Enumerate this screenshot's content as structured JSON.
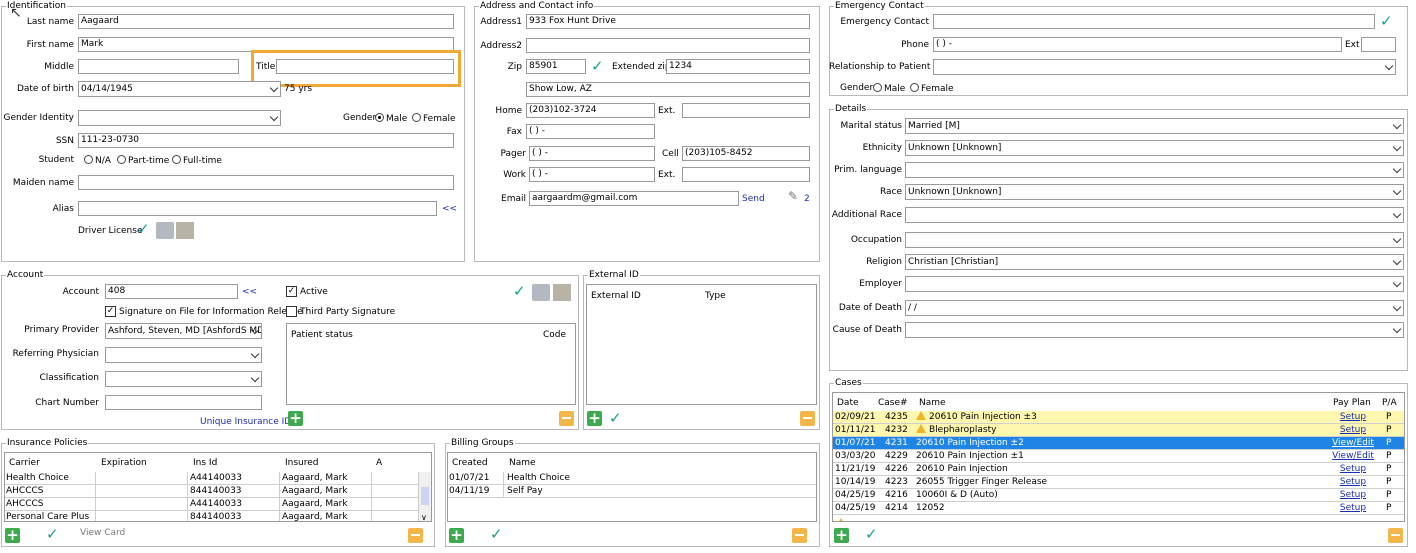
{
  "identification": {
    "legend": "Identification",
    "last_name_label": "Last name",
    "last_name": "Aagaard",
    "first_name_label": "First name",
    "first_name": "Mark",
    "middle_label": "Middle",
    "middle": "",
    "title_label": "Title",
    "title": "",
    "dob_label": "Date of birth",
    "dob": "04/14/1945",
    "age": "75 yrs",
    "gender_identity_label": "Gender Identity",
    "gender_identity": "",
    "gender_label": "Gender",
    "gender_male": "Male",
    "gender_female": "Female",
    "ssn_label": "SSN",
    "ssn": "111-23-0730",
    "student_label": "Student",
    "student_na": "N/A",
    "student_part": "Part-time",
    "student_full": "Full-time",
    "maiden_label": "Maiden name",
    "maiden": "",
    "alias_label": "Alias",
    "alias": "",
    "alias_arrow": "<<",
    "driver_license_label": "Driver License"
  },
  "address": {
    "legend": "Address and Contact info",
    "address1_label": "Address1",
    "address1": "933 Fox Hunt Drive",
    "address2_label": "Address2",
    "address2": "",
    "zip_label": "Zip",
    "zip": "85901",
    "ext_zip_label": "Extended zip",
    "ext_zip": "1234",
    "city": "Show Low, AZ",
    "home_label": "Home",
    "home": "(203)102-3724",
    "home_ext_label": "Ext.",
    "home_ext": "",
    "fax_label": "Fax",
    "fax": "(  )   -",
    "pager_label": "Pager",
    "pager": "(  )   -",
    "cell_label": "Cell",
    "cell": "(203)105-8452",
    "work_label": "Work",
    "work": "(  )   -",
    "work_ext_label": "Ext.",
    "work_ext": "",
    "email_label": "Email",
    "email": "aargaardm@gmail.com",
    "send": "Send",
    "attach_count": "2"
  },
  "emergency": {
    "legend": "Emergency Contact",
    "contact_label": "Emergency Contact",
    "contact": "",
    "phone_label": "Phone",
    "phone": "(  )   -",
    "ext_label": "Ext",
    "ext": "",
    "relationship_label": "Relationship to Patient",
    "relationship": "",
    "gender_label": "Gender",
    "gender_male": "Male",
    "gender_female": "Female"
  },
  "details": {
    "legend": "Details",
    "fields": [
      {
        "label": "Marital status",
        "value": "Married  [M]"
      },
      {
        "label": "Ethnicity",
        "value": "Unknown  [Unknown]"
      },
      {
        "label": "Prim. language",
        "value": ""
      },
      {
        "label": "Race",
        "value": "Unknown  [Unknown]"
      },
      {
        "label": "Additional Race",
        "value": ""
      },
      {
        "label": "Occupation",
        "value": ""
      },
      {
        "label": "Religion",
        "value": "Christian  [Christian]"
      },
      {
        "label": "Employer",
        "value": ""
      },
      {
        "label": "Date of Death",
        "value": " /  /"
      },
      {
        "label": "Cause of Death",
        "value": ""
      }
    ]
  },
  "account": {
    "legend": "Account",
    "account_label": "Account",
    "account": "408",
    "account_arrow": "<<",
    "active_label": "Active",
    "signature_label": "Signature on File for Information Release",
    "third_party_label": "Third Party Signature",
    "primary_provider_label": "Primary Provider",
    "primary_provider": "Ashford, Steven, MD  [AshfordS MD]",
    "referring_label": "Referring Physician",
    "referring": "",
    "classification_label": "Classification",
    "classification": "",
    "chart_label": "Chart Number",
    "chart": "",
    "unique_insurance_id": "Unique Insurance ID",
    "status_col": "Patient status",
    "code_col": "Code"
  },
  "external_id": {
    "legend": "External ID",
    "col_id": "External ID",
    "col_type": "Type"
  },
  "insurance": {
    "legend": "Insurance Policies",
    "columns": [
      "Carrier",
      "Expiration",
      "Ins Id",
      "Insured",
      "A"
    ],
    "rows": [
      [
        "Health Choice",
        "",
        "A44140033",
        "Aagaard, Mark",
        ""
      ],
      [
        "AHCCCS",
        "",
        "844140033",
        "Aagaard, Mark",
        ""
      ],
      [
        "AHCCCS",
        "",
        "A44140033",
        "Aagaard, Mark",
        ""
      ],
      [
        "Personal Care Plus",
        "",
        "844140033",
        "Aagaard, Mark",
        ""
      ]
    ],
    "view_card": "View Card"
  },
  "billing": {
    "legend": "Billing Groups",
    "columns": [
      "Created",
      "Name"
    ],
    "rows": [
      [
        "01/07/21",
        "Health Choice"
      ],
      [
        "04/11/19",
        "Self Pay"
      ]
    ]
  },
  "cases": {
    "legend": "Cases",
    "columns": [
      "Date",
      "Case#",
      "Name",
      "Pay Plan",
      "P/A"
    ],
    "rows": [
      {
        "date": "02/09/21",
        "case": "4235",
        "name": "20610 Pain Injection ±3",
        "plan": "Setup",
        "pa": "P",
        "warn": true,
        "style": "yel"
      },
      {
        "date": "01/11/21",
        "case": "4232",
        "name": "Blepharoplasty",
        "plan": "Setup",
        "pa": "P",
        "warn": true,
        "style": "yel"
      },
      {
        "date": "01/07/21",
        "case": "4231",
        "name": "20610 Pain Injection ±2",
        "plan": "View/Edit",
        "pa": "P",
        "warn": false,
        "style": "sel"
      },
      {
        "date": "03/03/20",
        "case": "4229",
        "name": "20610 Pain Injection ±1",
        "plan": "View/Edit",
        "pa": "P",
        "warn": false,
        "style": ""
      },
      {
        "date": "11/21/19",
        "case": "4226",
        "name": "20610 Pain Injection",
        "plan": "Setup",
        "pa": "P",
        "warn": false,
        "style": ""
      },
      {
        "date": "10/14/19",
        "case": "4223",
        "name": "26055  Trigger Finger Release",
        "plan": "Setup",
        "pa": "P",
        "warn": false,
        "style": ""
      },
      {
        "date": "04/25/19",
        "case": "4216",
        "name": "10060I & D  (Auto)",
        "plan": "Setup",
        "pa": "P",
        "warn": false,
        "style": ""
      },
      {
        "date": "04/25/19",
        "case": "4214",
        "name": "12052",
        "plan": "Setup",
        "pa": "P",
        "warn": false,
        "style": ""
      }
    ]
  }
}
